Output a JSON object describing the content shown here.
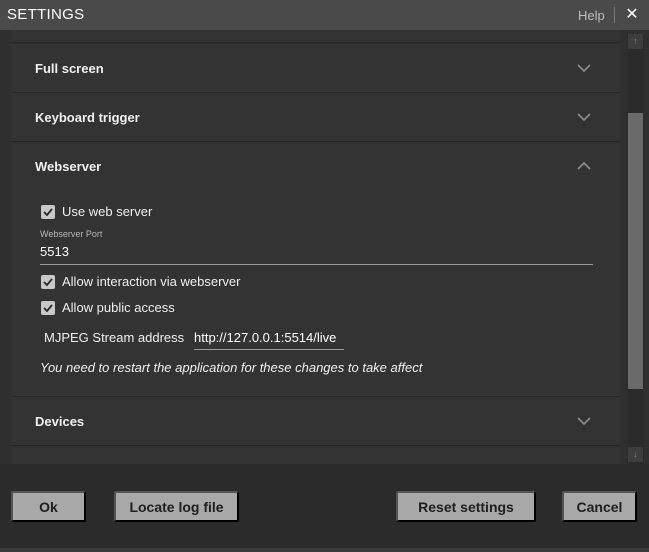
{
  "window": {
    "title": "SETTINGS",
    "help_label": "Help",
    "close_glyph": "✕"
  },
  "panels": {
    "full_screen": {
      "title": "Full screen",
      "expanded": false
    },
    "keyboard_trigger": {
      "title": "Keyboard trigger",
      "expanded": false
    },
    "webserver": {
      "title": "Webserver",
      "expanded": true,
      "use_web_server": {
        "label": "Use web server",
        "checked": true
      },
      "port": {
        "label": "Webserver Port",
        "value": "5513"
      },
      "allow_interaction": {
        "label": "Allow interaction via webserver",
        "checked": true
      },
      "allow_public": {
        "label": "Allow public access",
        "checked": true
      },
      "stream": {
        "label": "MJPEG Stream address",
        "value": "http://127.0.0.1:5514/live"
      },
      "note": "You need to restart the application for these changes to take affect"
    },
    "devices": {
      "title": "Devices",
      "expanded": false
    }
  },
  "icons": {
    "chevron_down": "chevron-down-icon",
    "chevron_up": "chevron-up-icon",
    "checkbox_check": "check-icon",
    "close": "close-icon"
  },
  "scrollbar": {
    "up_glyph": "↑",
    "down_glyph": "↓"
  },
  "footer": {
    "ok_label": "Ok",
    "locate_log_label": "Locate log file",
    "reset_label": "Reset settings",
    "cancel_label": "Cancel"
  },
  "colors": {
    "background": "#2b2b2b",
    "panel": "#333333",
    "titlebar": "#4a4a4a",
    "button": "#a8a8a8",
    "checkbox": "#c8c8c8"
  }
}
